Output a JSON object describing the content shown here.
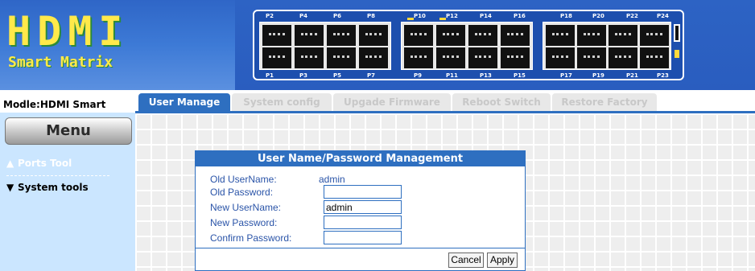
{
  "header": {
    "logo_title": "HDMI",
    "logo_subtitle": "Smart Matrix",
    "ports_top": [
      "P2",
      "P4",
      "P6",
      "P8",
      "P10",
      "P12",
      "P14",
      "P16",
      "P18",
      "P20",
      "P22",
      "P24"
    ],
    "ports_bottom": [
      "P1",
      "P3",
      "P5",
      "P7",
      "P9",
      "P11",
      "P13",
      "P15",
      "P17",
      "P19",
      "P21",
      "P23"
    ]
  },
  "sidebar": {
    "model_label": "Modle:HDMI Smart Matrix",
    "menu_label": "Menu",
    "items": [
      {
        "label": "Ports Tool",
        "arrow": "▲",
        "state": "disabled"
      },
      {
        "label": "System tools",
        "arrow": "▼",
        "state": "active"
      }
    ]
  },
  "tabs": [
    {
      "label": "User Manage",
      "active": true
    },
    {
      "label": "System config",
      "active": false
    },
    {
      "label": "Upgade Firmware",
      "active": false
    },
    {
      "label": "Reboot Switch",
      "active": false
    },
    {
      "label": "Restore Factory",
      "active": false
    }
  ],
  "dialog": {
    "title": "User Name/Password Management",
    "old_username_label": "Old UserName:",
    "old_username_value": "admin",
    "old_password_label": "Old Password:",
    "old_password_value": "",
    "new_username_label": "New UserName:",
    "new_username_value": "admin",
    "new_password_label": "New Password:",
    "new_password_value": "",
    "confirm_password_label": "Confirm Password:",
    "confirm_password_value": "",
    "cancel_label": "Cancel",
    "apply_label": "Apply"
  },
  "colors": {
    "accent": "#2e6fc0",
    "sidebar_bg": "#cbe6ff",
    "logo_text": "#ffe94a",
    "header_bg": "#2d63c4"
  }
}
